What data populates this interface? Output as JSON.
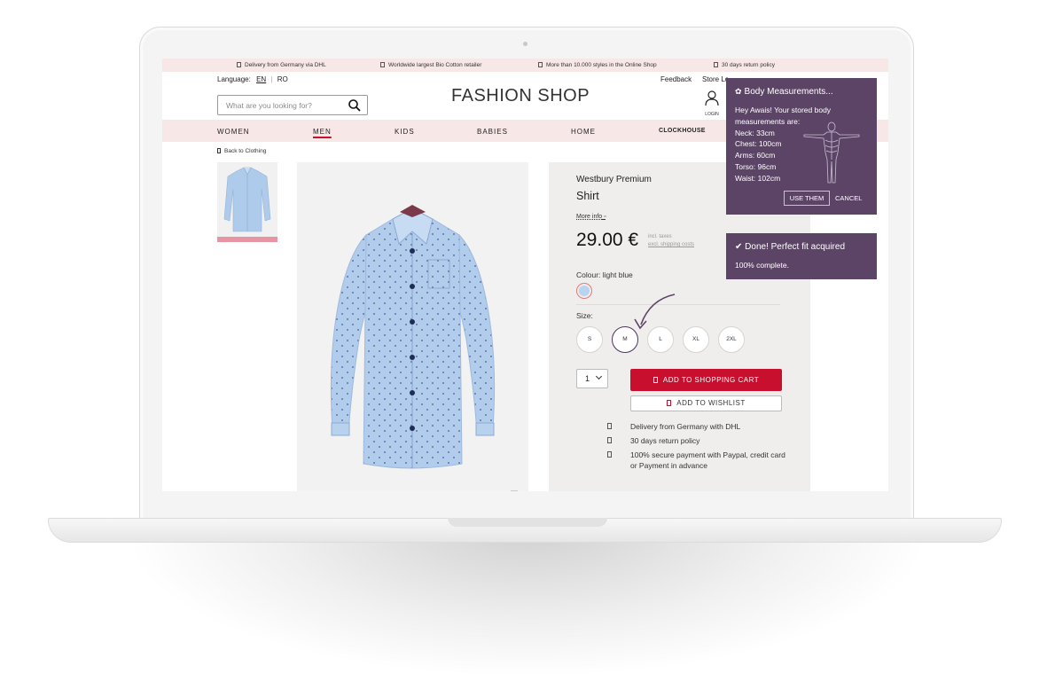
{
  "infobar": {
    "items": [
      "Delivery from Germany via DHL",
      "Worldwide largest Bio Cotton retailer",
      "More than 10.000 styles in the Online Shop",
      "30 days return policy"
    ]
  },
  "header": {
    "language_label": "Language:",
    "lang_en": "EN",
    "lang_ro": "RO",
    "feedback": "Feedback",
    "store_locator": "Store Lo",
    "search_placeholder": "What are you looking for?",
    "logo": "FASHION SHOP",
    "login": "LOGIN"
  },
  "nav": {
    "items": [
      "WOMEN",
      "MEN",
      "KIDS",
      "BABIES",
      "HOME",
      "CLOCKHOUSE"
    ]
  },
  "breadcrumb": {
    "back": "Back to Clothing"
  },
  "product": {
    "brand": "Westbury Premium",
    "name": "Shirt",
    "more_info": "More info",
    "price": "29.00 €",
    "tax_line1": "incl. taxes",
    "tax_line2": "excl. shipping costs",
    "colour_label": "Colour: light blue",
    "size_label": "Size:",
    "sizes": [
      "S",
      "M",
      "L",
      "XL",
      "2XL"
    ],
    "selected_size": "M",
    "quantity": "1",
    "add_to_cart": "ADD TO SHOPPING CART",
    "add_to_wishlist": "ADD TO WISHLIST",
    "features": [
      "Delivery from Germany with DHL",
      "30 days return policy",
      "100% secure payment with Paypal, credit card or Payment in advance"
    ]
  },
  "measurements_popup": {
    "title": "Body Measurements...",
    "intro": "Hey Awais! Your stored body measurements are:",
    "lines": [
      "Neck: 33cm",
      "Chest: 100cm",
      "Arms: 60cm",
      "Torso: 96cm",
      "Waist: 102cm"
    ],
    "use_button": "USE THEM",
    "cancel_button": "CANCEL"
  },
  "fit_popup": {
    "title": "Done! Perfect fit acquired",
    "subtitle": "100% complete."
  },
  "colors": {
    "accent_red": "#c8102e",
    "popup_purple": "#5c4466",
    "nav_pink": "#f8e7e7"
  }
}
